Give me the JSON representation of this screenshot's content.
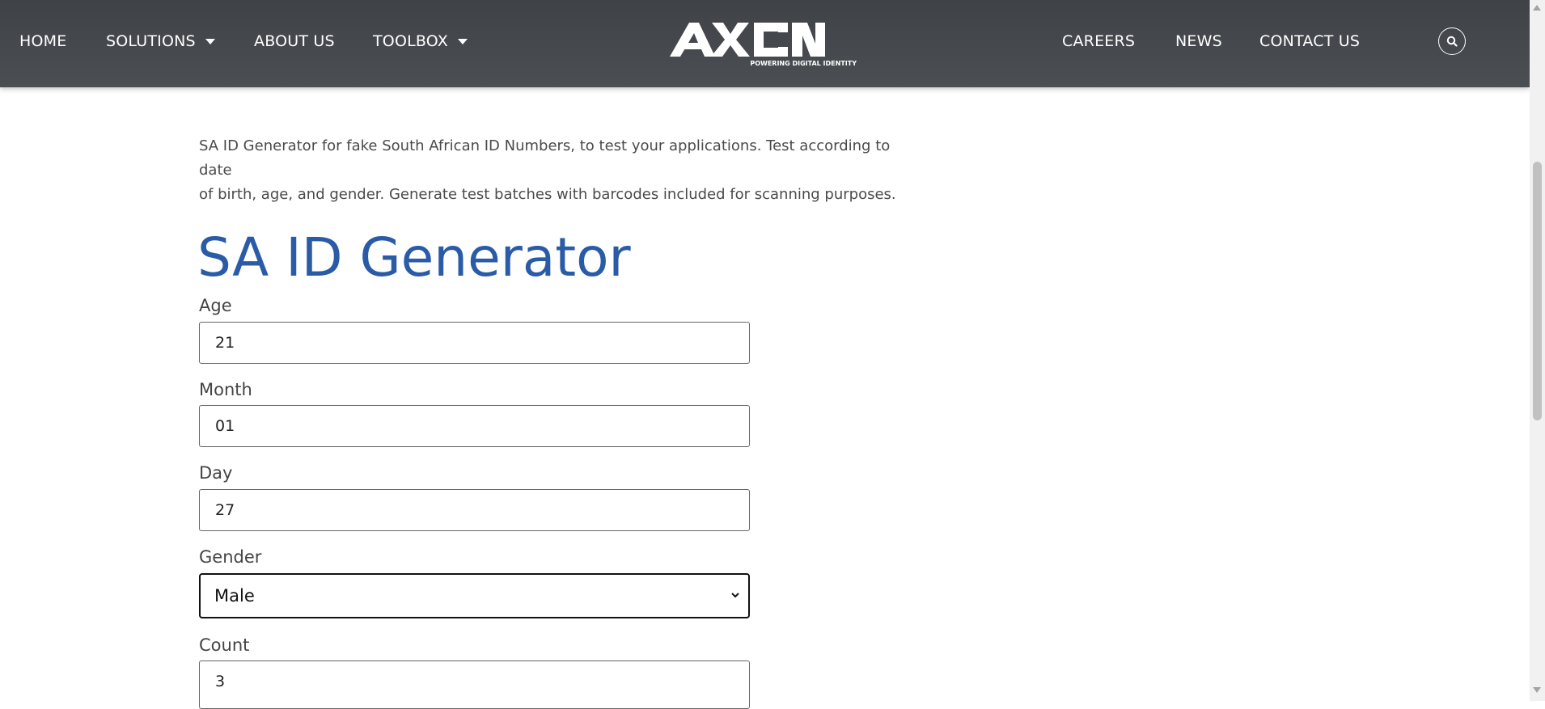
{
  "nav": {
    "left": [
      {
        "label": "HOME"
      },
      {
        "label": "SOLUTIONS"
      },
      {
        "label": "ABOUT US"
      },
      {
        "label": "TOOLBOX"
      }
    ],
    "right": [
      {
        "label": "CAREERS"
      },
      {
        "label": "NEWS"
      },
      {
        "label": "CONTACT US"
      }
    ],
    "search_icon": "search-icon"
  },
  "logo": {
    "brand": "AXON",
    "tagline": "POWERING DIGITAL IDENTITY"
  },
  "intro": {
    "line1": "SA ID Generator for fake South African ID Numbers, to test your applications. Test according to date",
    "line2": "of birth, age, and gender. Generate test batches with barcodes included for scanning purposes."
  },
  "page_title": "SA ID Generator",
  "form": {
    "age": {
      "label": "Age",
      "value": "21"
    },
    "month": {
      "label": "Month",
      "value": "01"
    },
    "day": {
      "label": "Day",
      "value": "27"
    },
    "gender": {
      "label": "Gender",
      "value": "Male"
    },
    "count": {
      "label": "Count",
      "value": "3"
    }
  },
  "colors": {
    "header_bg": "#46494d",
    "title_blue": "#2a5ba7"
  }
}
